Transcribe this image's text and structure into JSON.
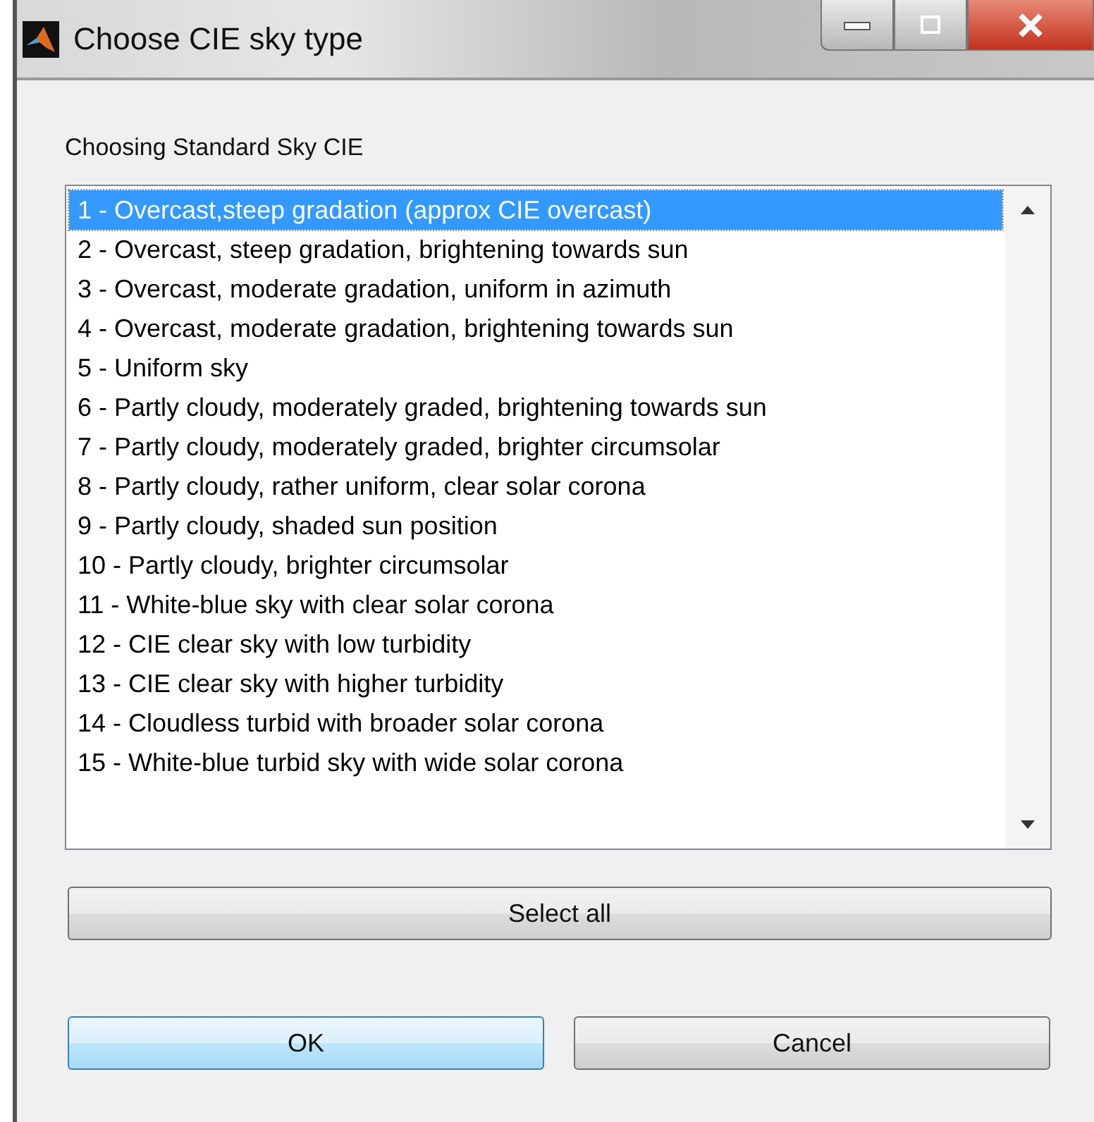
{
  "window": {
    "title": "Choose CIE sky type"
  },
  "label": "Choosing Standard Sky CIE",
  "list": {
    "items": [
      {
        "text": "1 - Overcast,steep gradation (approx CIE overcast)",
        "selected": true
      },
      {
        "text": "2 - Overcast, steep gradation, brightening towards sun",
        "selected": false
      },
      {
        "text": "3 - Overcast, moderate gradation, uniform in azimuth",
        "selected": false
      },
      {
        "text": "4 - Overcast, moderate gradation, brightening towards sun",
        "selected": false
      },
      {
        "text": "5 - Uniform sky",
        "selected": false
      },
      {
        "text": "6 - Partly cloudy, moderately graded, brightening towards sun",
        "selected": false
      },
      {
        "text": "7 - Partly cloudy, moderately graded, brighter circumsolar",
        "selected": false
      },
      {
        "text": "8 - Partly cloudy, rather uniform, clear solar corona",
        "selected": false
      },
      {
        "text": "9 - Partly cloudy, shaded sun position",
        "selected": false
      },
      {
        "text": "10 - Partly cloudy, brighter circumsolar",
        "selected": false
      },
      {
        "text": "11 - White-blue sky with clear solar corona",
        "selected": false
      },
      {
        "text": "12 - CIE clear sky with low turbidity",
        "selected": false
      },
      {
        "text": "13 - CIE clear sky with higher turbidity",
        "selected": false
      },
      {
        "text": "14 - Cloudless turbid with broader solar corona",
        "selected": false
      },
      {
        "text": "15 - White-blue turbid sky with wide solar corona",
        "selected": false
      }
    ]
  },
  "select_all_button": "Select all",
  "buttons": [
    {
      "label": "OK",
      "default": true
    },
    {
      "label": "Cancel",
      "default": false
    }
  ]
}
